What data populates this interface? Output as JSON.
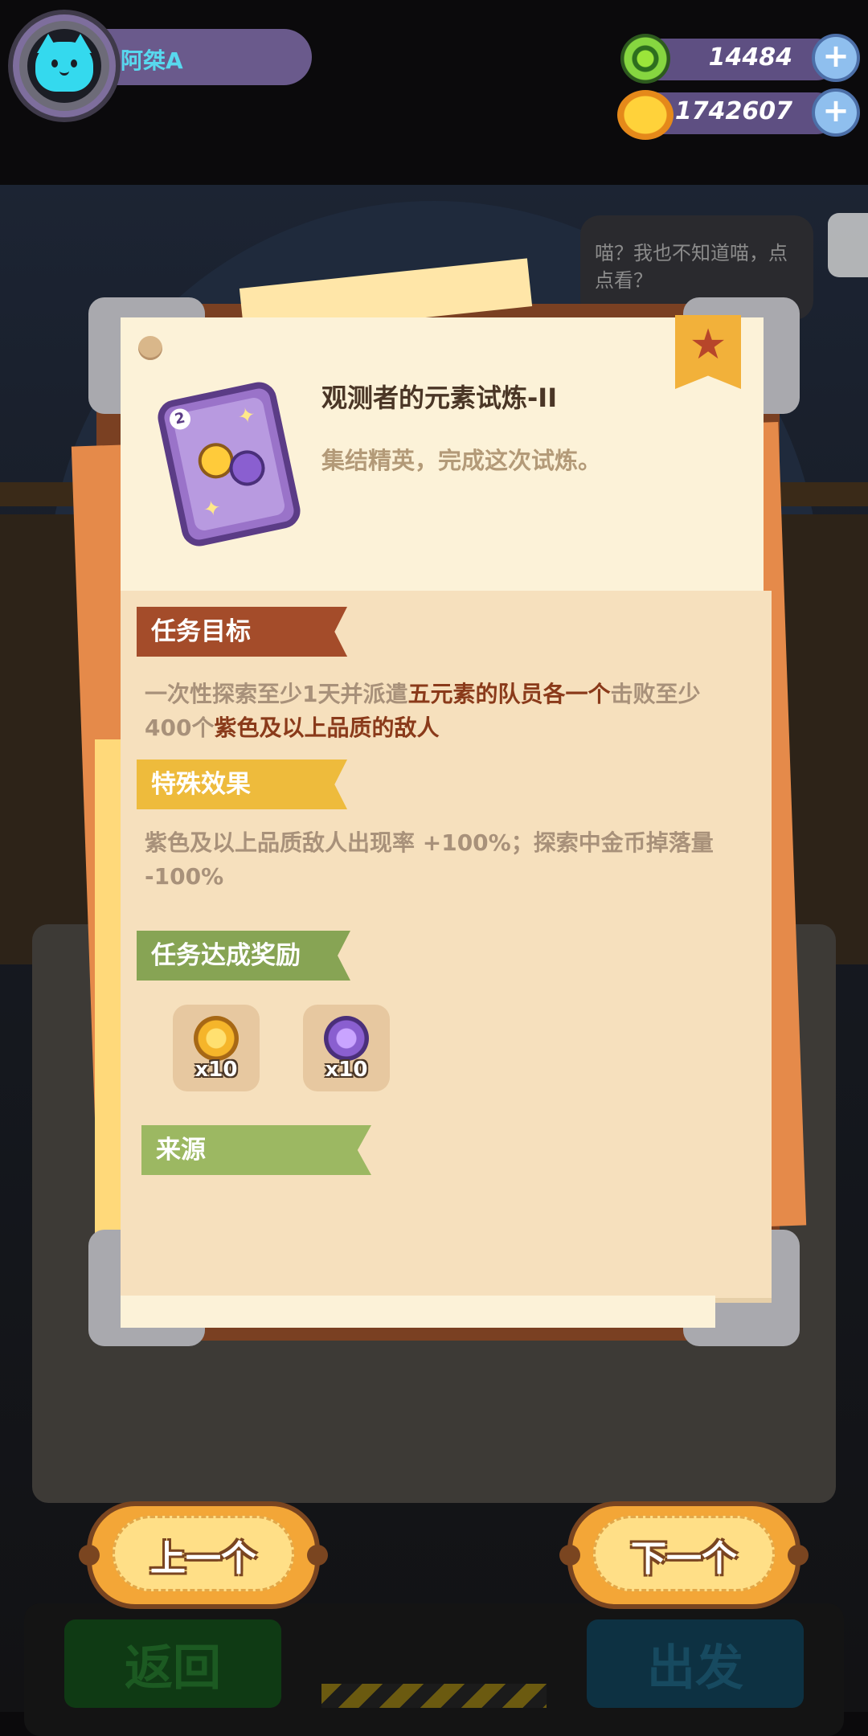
{
  "player": {
    "name": "阿桀A"
  },
  "currencies": [
    {
      "name": "green-gem",
      "value": "14484"
    },
    {
      "name": "gold-planet",
      "value": "1742607"
    }
  ],
  "background": {
    "speech_bubble": "喵？我也不知道喵，点点看？",
    "back_button": "返回",
    "go_button": "出发"
  },
  "quest": {
    "title": "观测者的元素试炼-II",
    "subtitle": "集结精英，完成这次试炼。",
    "sections": {
      "goal_label": "任务目标",
      "effect_label": "特殊效果",
      "reward_label": "任务达成奖励",
      "source_label": "来源"
    },
    "goal_text": {
      "part1": "一次性探索至少1天并派遣",
      "part2": "五元素的队员各一个",
      "part3": "击败至少400个",
      "part4": "紫色及以上品质的敌人"
    },
    "effect_text": "紫色及以上品质敌人出现率 +100%；探索中金币掉落量 -100%",
    "rewards": [
      {
        "icon": "gold-coin-icon",
        "count": "x10"
      },
      {
        "icon": "purple-coin-icon",
        "count": "x10"
      }
    ]
  },
  "nav": {
    "prev_label": "上一个",
    "next_label": "下一个"
  }
}
